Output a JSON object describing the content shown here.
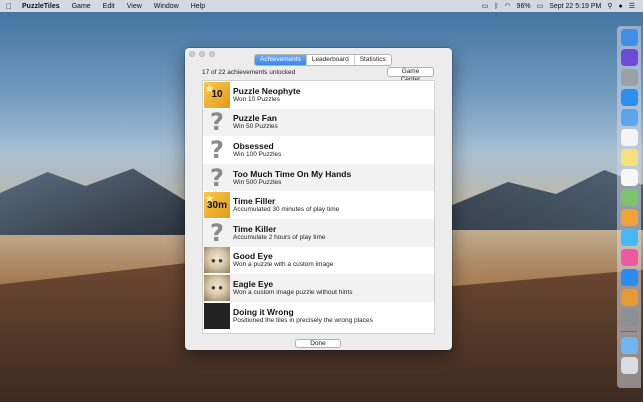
{
  "menubar": {
    "apple": "",
    "app_name": "PuzzleTiles",
    "items": [
      "Game",
      "Edit",
      "View",
      "Window",
      "Help"
    ],
    "battery": "96%",
    "clock": "Sept 22  5:19 PM"
  },
  "window": {
    "tabs": [
      {
        "label": "Achievements",
        "active": true
      },
      {
        "label": "Leaderboard",
        "active": false
      },
      {
        "label": "Statistics",
        "active": false
      }
    ],
    "summary": "17 of 22 achievements unlocked",
    "game_center_label": "Game Center",
    "done_label": "Done",
    "achievements": [
      {
        "title": "Puzzle Neophyte",
        "desc": "Won 10 Puzzles",
        "icon": "badge",
        "badge_text": "10"
      },
      {
        "title": "Puzzle Fan",
        "desc": "Win 50 Puzzles",
        "icon": "question"
      },
      {
        "title": "Obsessed",
        "desc": "Win 100 Puzzles",
        "icon": "question"
      },
      {
        "title": "Too Much Time On My Hands",
        "desc": "Win 500 Puzzles",
        "icon": "question"
      },
      {
        "title": "Time Filler",
        "desc": "Accumulated 30 minutes of play time",
        "icon": "badge",
        "badge_text": "30m"
      },
      {
        "title": "Time Killer",
        "desc": "Accumulate 2 hours of play time",
        "icon": "question"
      },
      {
        "title": "Good Eye",
        "desc": "Won a puzzle with a custom image",
        "icon": "photo"
      },
      {
        "title": "Eagle Eye",
        "desc": "Won a custom image puzzle without hints",
        "icon": "photo"
      },
      {
        "title": "Doing it Wrong",
        "desc": "Positioned the tiles in precisely the wrong places",
        "icon": "grid"
      }
    ]
  },
  "dock": {
    "icons": [
      {
        "name": "finder-icon",
        "color": "#3d8fe8"
      },
      {
        "name": "siri-icon",
        "color": "#6b4bd8"
      },
      {
        "name": "launchpad-icon",
        "color": "#9aa0a8"
      },
      {
        "name": "safari-icon",
        "color": "#2c8ff0"
      },
      {
        "name": "mail-icon",
        "color": "#5aa6ec"
      },
      {
        "name": "calendar-icon",
        "color": "#f4f4f4"
      },
      {
        "name": "notes-icon",
        "color": "#f7e27a"
      },
      {
        "name": "reminders-icon",
        "color": "#f6f6f6"
      },
      {
        "name": "maps-icon",
        "color": "#7cc36b"
      },
      {
        "name": "photos-icon",
        "color": "#f1a33a"
      },
      {
        "name": "messages-icon",
        "color": "#47b8f7"
      },
      {
        "name": "itunes-icon",
        "color": "#ee5a9e"
      },
      {
        "name": "app-store-icon",
        "color": "#2a8cf0"
      },
      {
        "name": "puzzletiles-icon",
        "color": "#e69a34"
      },
      {
        "name": "system-preferences-icon",
        "color": "#8b8f96"
      },
      {
        "name": "downloads-folder-icon",
        "color": "#6fb7ee"
      },
      {
        "name": "trash-icon",
        "color": "#d9dde2"
      }
    ]
  }
}
